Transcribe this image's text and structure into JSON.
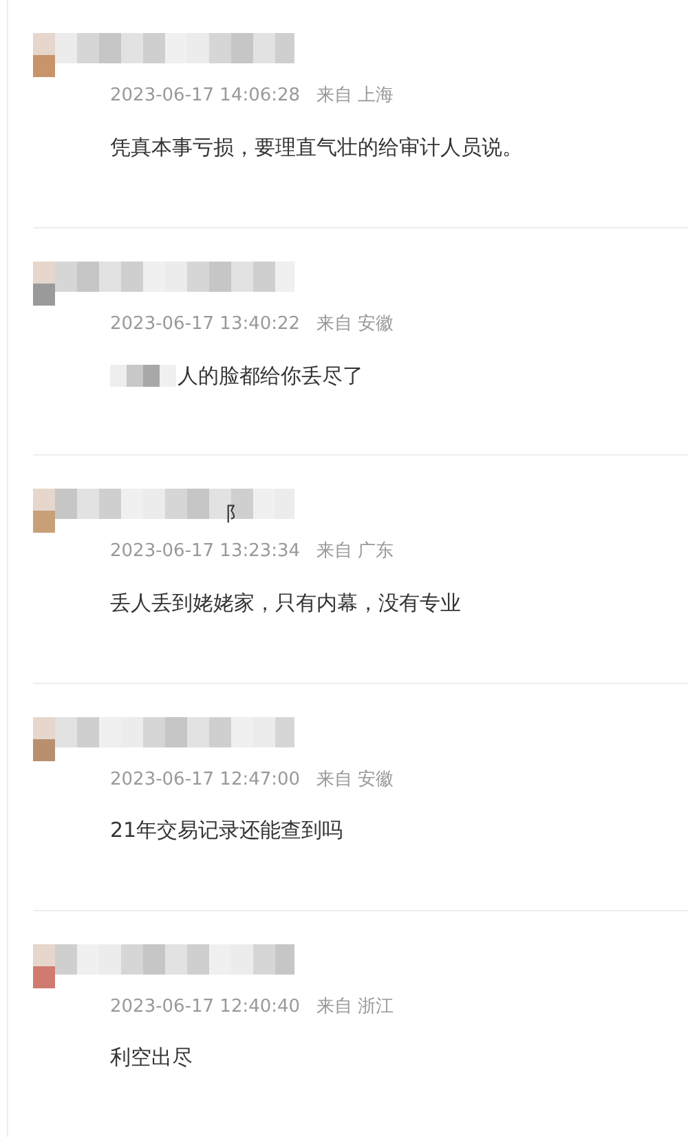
{
  "comments": [
    {
      "time": "2023-06-17 14:06:28",
      "from_label": "来自",
      "location": "上海",
      "content": "凭真本事亏损，要理直气壮的给审计人员说。",
      "content_redacted": false
    },
    {
      "time": "2023-06-17 13:40:22",
      "from_label": "来自",
      "location": "安徽",
      "content": "人的脸都给你丢尽了",
      "content_redacted": true
    },
    {
      "name_fragment": "阝",
      "time": "2023-06-17 13:23:34",
      "from_label": "来自",
      "location": "广东",
      "content": "丢人丢到姥姥家，只有内幕，没有专业",
      "content_redacted": false
    },
    {
      "time": "2023-06-17 12:47:00",
      "from_label": "来自",
      "location": "安徽",
      "content": "21年交易记录还能查到吗",
      "content_redacted": false
    },
    {
      "time": "2023-06-17 12:40:40",
      "from_label": "来自",
      "location": "浙江",
      "content": "利空出尽",
      "content_redacted": false
    }
  ]
}
